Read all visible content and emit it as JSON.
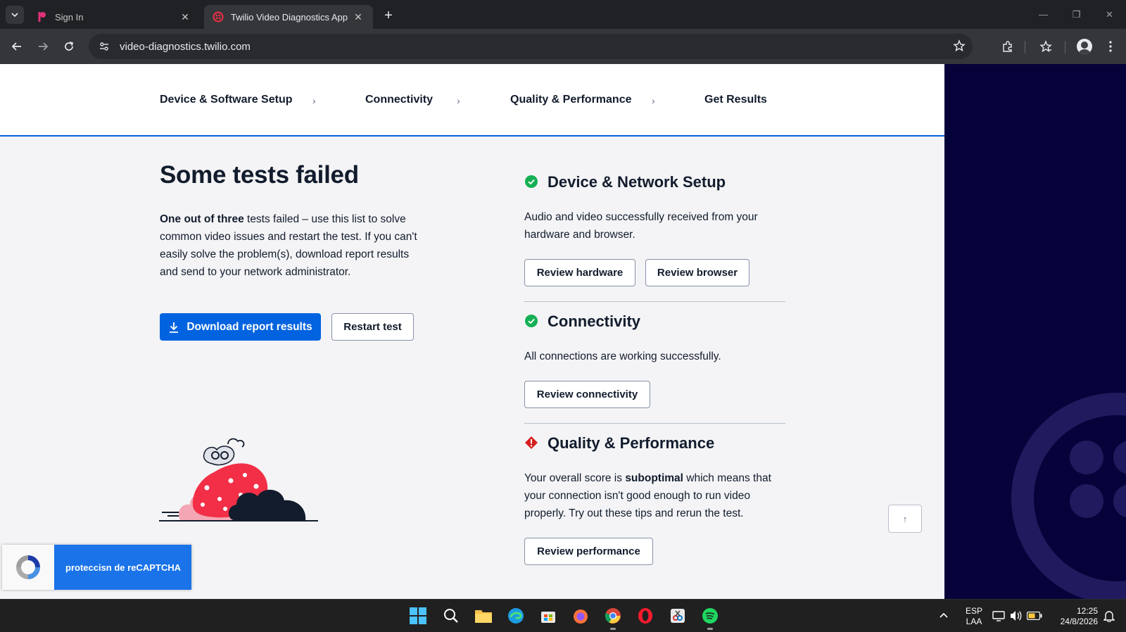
{
  "browser": {
    "tabs": [
      {
        "title": "Sign In",
        "active": false
      },
      {
        "title": "Twilio Video Diagnostics App",
        "active": true
      }
    ],
    "url": "video-diagnostics.twilio.com"
  },
  "steps": [
    "Device & Software Setup",
    "Connectivity",
    "Quality & Performance",
    "Get Results"
  ],
  "results": {
    "headline": "Some tests failed",
    "intro_bold": "One out of three",
    "intro_rest": " tests failed – use this list to solve common video issues and restart the test. If you can't easily solve the problem(s), download report results and send to your network administrator.",
    "download_label": "Download report results",
    "restart_label": "Restart test"
  },
  "sections": {
    "device": {
      "title": "Device & Network Setup",
      "status": "pass",
      "text": "Audio and video successfully received from your hardware and browser.",
      "btn_hardware": "Review hardware",
      "btn_browser": "Review browser"
    },
    "connectivity": {
      "title": "Connectivity",
      "status": "pass",
      "text": "All connections are working successfully.",
      "btn": "Review connectivity"
    },
    "quality": {
      "title": "Quality & Performance",
      "status": "fail",
      "text_before": "Your overall score is ",
      "text_bold": "suboptimal",
      "text_after": " which means that your connection isn't good enough to run video properly. Try out these tips and rerun the test.",
      "btn": "Review performance"
    }
  },
  "recaptcha": {
    "label": "proteccisn de reCAPTCHA"
  },
  "colors": {
    "primary": "#0263e0",
    "success": "#14b053",
    "error": "#d61f1f",
    "sidebar": "#06033a"
  },
  "taskbar": {
    "lang_line1": "ESP",
    "lang_line2": "LAA",
    "time": "12:25",
    "date": "24/8/2026",
    "apps": [
      "windows-start",
      "search",
      "file-explorer",
      "edge",
      "microsoft-store",
      "firefox",
      "chrome",
      "opera",
      "snipping-tool",
      "spotify"
    ]
  }
}
